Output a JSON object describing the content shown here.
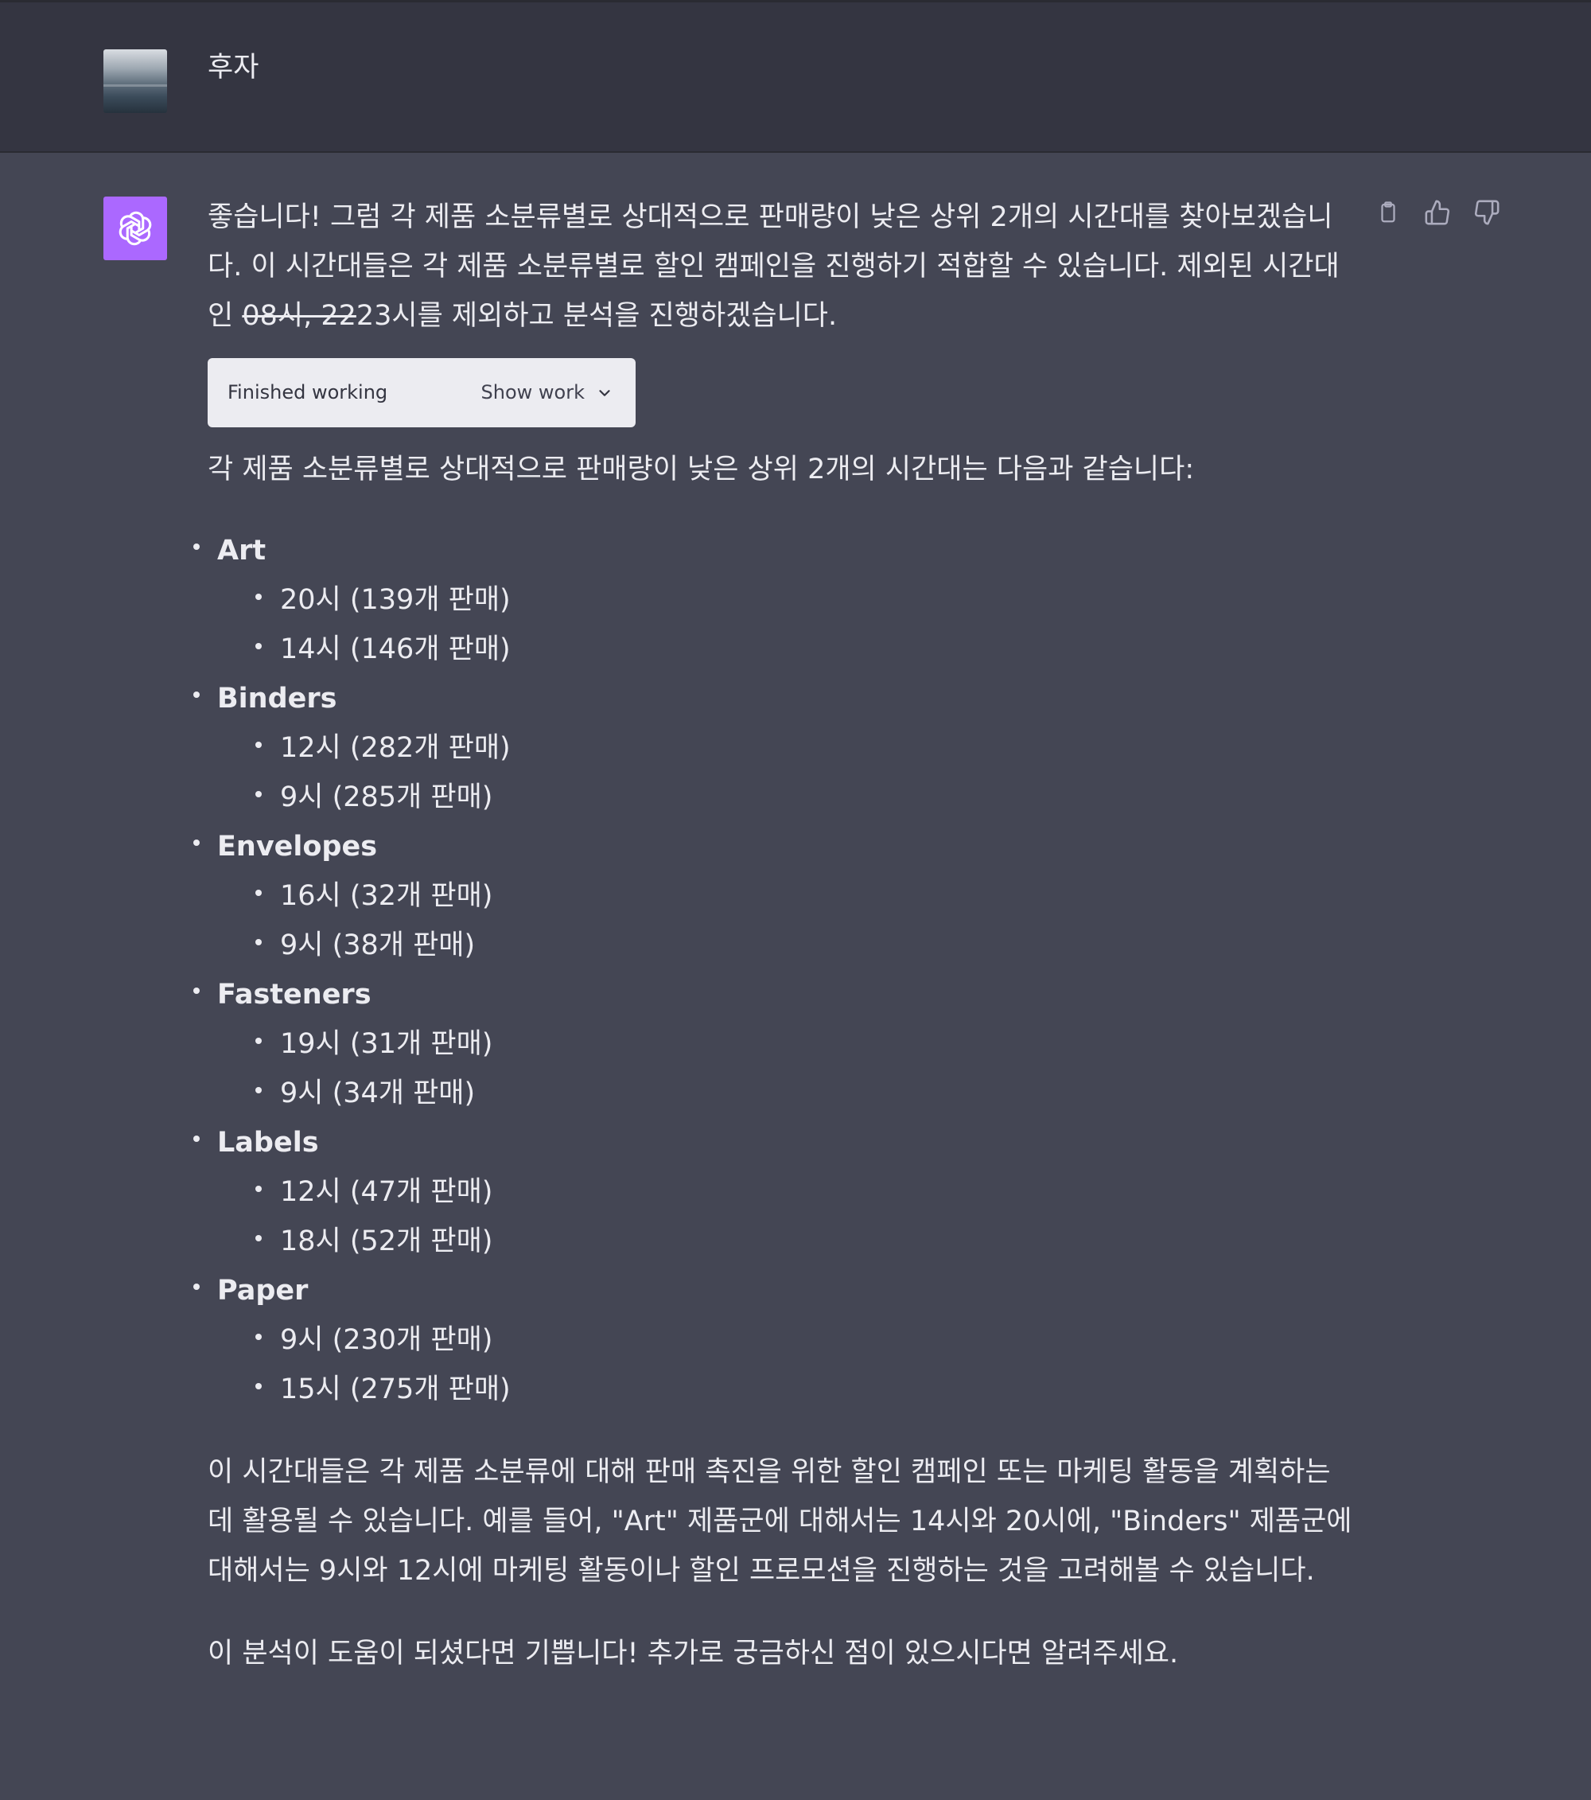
{
  "user_message": {
    "text": "후자"
  },
  "assistant_message": {
    "intro_part1": "좋습니다! 그럼 각 제품 소분류별로 상대적으로 판매량이 낮은 상위 2개의 시간대를 찾아보겠습니다. 이 시간대들은 각 제품 소분류별로 할인 캠페인을 진행하기 적합할 수 있습니다. 제외된 시간대인 ",
    "intro_strike": "08시, 22",
    "intro_part2": "23시를 제외하고 분석을 진행하겠습니다.",
    "work_status": "Finished working",
    "show_work_label": "Show work",
    "summary": "각 제품 소분류별로 상대적으로 판매량이 낮은 상위 2개의 시간대는 다음과 같습니다:",
    "categories": [
      {
        "name": "Art",
        "items": [
          "20시 (139개 판매)",
          "14시 (146개 판매)"
        ]
      },
      {
        "name": "Binders",
        "items": [
          "12시 (282개 판매)",
          "9시 (285개 판매)"
        ]
      },
      {
        "name": "Envelopes",
        "items": [
          "16시 (32개 판매)",
          "9시 (38개 판매)"
        ]
      },
      {
        "name": "Fasteners",
        "items": [
          "19시 (31개 판매)",
          "9시 (34개 판매)"
        ]
      },
      {
        "name": "Labels",
        "items": [
          "12시 (47개 판매)",
          "18시 (52개 판매)"
        ]
      },
      {
        "name": "Paper",
        "items": [
          "9시 (230개 판매)",
          "15시 (275개 판매)"
        ]
      }
    ],
    "conclusion": "이 시간대들은 각 제품 소분류에 대해 판매 촉진을 위한 할인 캠페인 또는 마케팅 활동을 계획하는 데 활용될 수 있습니다. 예를 들어, \"Art\" 제품군에 대해서는 14시와 20시에, \"Binders\" 제품군에 대해서는 9시와 12시에 마케팅 활동이나 할인 프로모션을 진행하는 것을 고려해볼 수 있습니다.",
    "closing": "이 분석이 도움이 되셨다면 기쁩니다! 추가로 궁금하신 점이 있으시다면 알려주세요."
  },
  "icons": {
    "copy": "clipboard-icon",
    "like": "thumbs-up-icon",
    "dislike": "thumbs-down-icon",
    "assistant_avatar": "openai-logo-icon",
    "chevron": "chevron-down-icon"
  },
  "colors": {
    "user_bg": "#343541",
    "assistant_bg": "#444654",
    "avatar_accent": "#ab68ff",
    "text": "#ececf1"
  }
}
